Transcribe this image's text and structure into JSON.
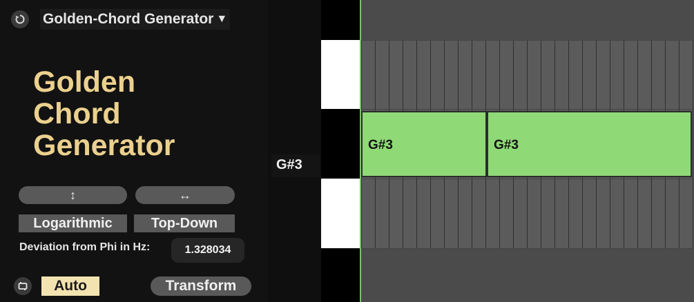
{
  "device": {
    "preset_name": "Golden-Chord Generator",
    "title_lines": [
      "Golden",
      "Chord",
      "Generator"
    ],
    "vertical_arrow": "↕",
    "horizontal_arrow": "↔",
    "mode_left": "Logarithmic",
    "mode_right": "Top-Down",
    "deviation_label": "Deviation from Phi in Hz:",
    "deviation_value": "1.328034",
    "auto_label": "Auto",
    "transform_label": "Transform",
    "accent_color": "#ebd08e"
  },
  "piano_roll": {
    "key_label": "G#3",
    "notes": [
      {
        "pitch": "G#3",
        "label": "G#3"
      },
      {
        "pitch": "G#3",
        "label": "G#3"
      }
    ],
    "note_color": "#8fd977"
  }
}
